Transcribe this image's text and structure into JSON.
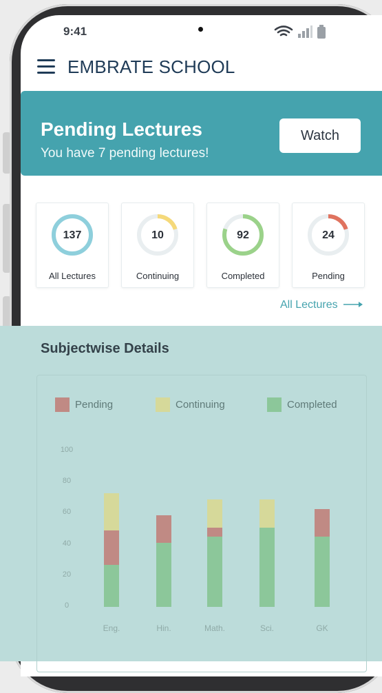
{
  "status_bar": {
    "time": "9:41"
  },
  "header": {
    "title": "EMBRATE SCHOOL"
  },
  "banner": {
    "title": "Pending Lectures",
    "subtitle": "You have 7 pending lectures!",
    "button_label": "Watch",
    "color": "#45a3ae"
  },
  "stats": [
    {
      "value": "137",
      "label": "All Lectures",
      "progress": 1.0,
      "color": "#8ecfdc"
    },
    {
      "value": "10",
      "label": "Continuing",
      "progress": 0.2,
      "color": "#f5d97a"
    },
    {
      "value": "92",
      "label": "Completed",
      "progress": 0.8,
      "color": "#9bd28a"
    },
    {
      "value": "24",
      "label": "Pending",
      "progress": 0.2,
      "color": "#e0735f"
    }
  ],
  "all_lectures_link": "All Lectures",
  "subjectwise": {
    "title": "Subjectwise Details"
  },
  "chart_data": {
    "type": "bar",
    "stacked": true,
    "categories": [
      "Eng.",
      "Hin.",
      "Math.",
      "Sci.",
      "GK"
    ],
    "series": [
      {
        "name": "Completed",
        "color": "#8cc79a",
        "values": [
          27,
          41,
          45,
          51,
          45
        ]
      },
      {
        "name": "Pending",
        "color": "#c08a84",
        "values": [
          22,
          18,
          6,
          0,
          18
        ]
      },
      {
        "name": "Continuing",
        "color": "#d6d99a",
        "values": [
          24,
          0,
          18,
          18,
          0
        ]
      }
    ],
    "legend_order": [
      "Pending",
      "Continuing",
      "Completed"
    ],
    "yticks": [
      "0",
      "20",
      "40",
      "60",
      "80",
      "100"
    ],
    "ylim": [
      0,
      100
    ],
    "legend": "top"
  }
}
